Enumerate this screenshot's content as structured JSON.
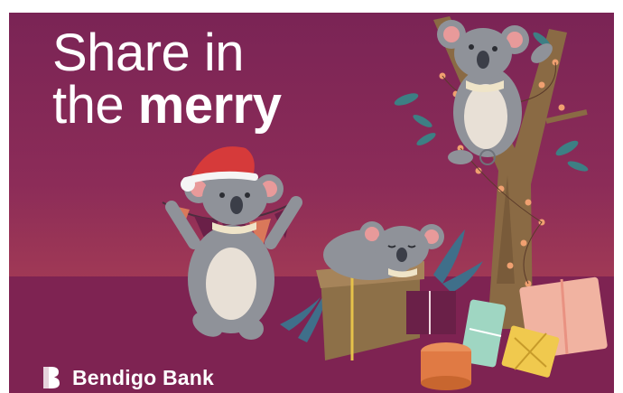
{
  "headline": {
    "line1": "Share in",
    "line2_regular": "the ",
    "line2_bold": "merry"
  },
  "brand": {
    "name": "Bendigo Bank",
    "logo_icon": "bendigo-b-logo"
  },
  "colors": {
    "background": "#8c2c58",
    "floor": "#7e2352",
    "text": "#ffffff",
    "koala_grey": "#8f9299",
    "hat_red": "#d63a3a"
  },
  "illustration": {
    "characters": [
      "koala-dancing-with-bunting",
      "koala-sleeping-on-present",
      "koala-climbing-tree-with-lights"
    ],
    "props": [
      "christmas-tree-branch",
      "fairy-lights",
      "wrapped-presents",
      "bunting-flags",
      "fern-leaves"
    ]
  }
}
